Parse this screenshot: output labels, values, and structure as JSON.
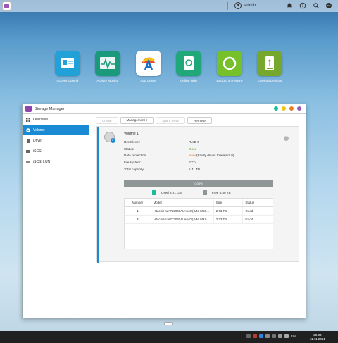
{
  "topbar": {
    "username": "admin",
    "icons": [
      "user-icon",
      "notification-icon",
      "info-icon",
      "search-icon",
      "more-icon"
    ]
  },
  "apps": [
    {
      "label": "Access Control",
      "icon": "access-control-icon",
      "color": "#22a0d8"
    },
    {
      "label": "Activity Monitor",
      "icon": "activity-monitor-icon",
      "color": "#1b9a7b"
    },
    {
      "label": "App Center",
      "icon": "app-center-icon",
      "color": "#ffffff"
    },
    {
      "label": "Online Help",
      "icon": "online-help-icon",
      "color": "#20a87a"
    },
    {
      "label": "Backup & Restore",
      "icon": "backup-restore-icon",
      "color": "#76c02a"
    },
    {
      "label": "External Devices",
      "icon": "external-devices-icon",
      "color": "#77a82e"
    }
  ],
  "window": {
    "title": "Storage Manager",
    "controls": [
      "#1abc9c",
      "#f1c40f",
      "#e67e22",
      "#9b59b6"
    ]
  },
  "sidebar": {
    "items": [
      {
        "label": "Overview",
        "icon": "overview-icon"
      },
      {
        "label": "Volume",
        "icon": "volume-icon",
        "active": true
      },
      {
        "label": "Drive",
        "icon": "drive-icon"
      },
      {
        "label": "iSCSI",
        "icon": "iscsi-icon"
      },
      {
        "label": "iSCSI LUN",
        "icon": "iscsi-lun-icon"
      }
    ]
  },
  "toolbar": {
    "create": "Create",
    "management": "Management ▾",
    "spare_drive": "Spare Drive",
    "remove": "Remove"
  },
  "volume": {
    "name": "Volume 1",
    "properties": [
      {
        "key": "RAID level:",
        "value": "RAID 0"
      },
      {
        "key": "Status:",
        "value": "Good",
        "color": "#5aa832"
      },
      {
        "key": "Data protection:",
        "value": "None",
        "suffix": " (Faulty drives tolerated: 0)",
        "color": "#e67e22"
      },
      {
        "key": "File system:",
        "value": "EXT4"
      },
      {
        "key": "Total capacity:",
        "value": "5.41 TB"
      }
    ],
    "usage_percent": "0.05%",
    "used": "Used 3.21 GB",
    "free": "Free 5.40 TB",
    "used_color": "#1abc9c",
    "free_color": "#8f9696"
  },
  "drives": {
    "headers": [
      "Number",
      "Model",
      "Size",
      "Status"
    ],
    "rows": [
      {
        "number": "1",
        "model": "Hitachi HUA723030ALA640 (S/N: MK0...",
        "size": "2.73 TB",
        "status": "Good"
      },
      {
        "number": "2",
        "model": "Hitachi HUA723030ALA640 (S/N: MK0...",
        "size": "2.73 TB",
        "status": "Good"
      }
    ]
  },
  "taskbar": {
    "lang": "FIN",
    "time": "20.33",
    "date": "11.11.2021"
  }
}
